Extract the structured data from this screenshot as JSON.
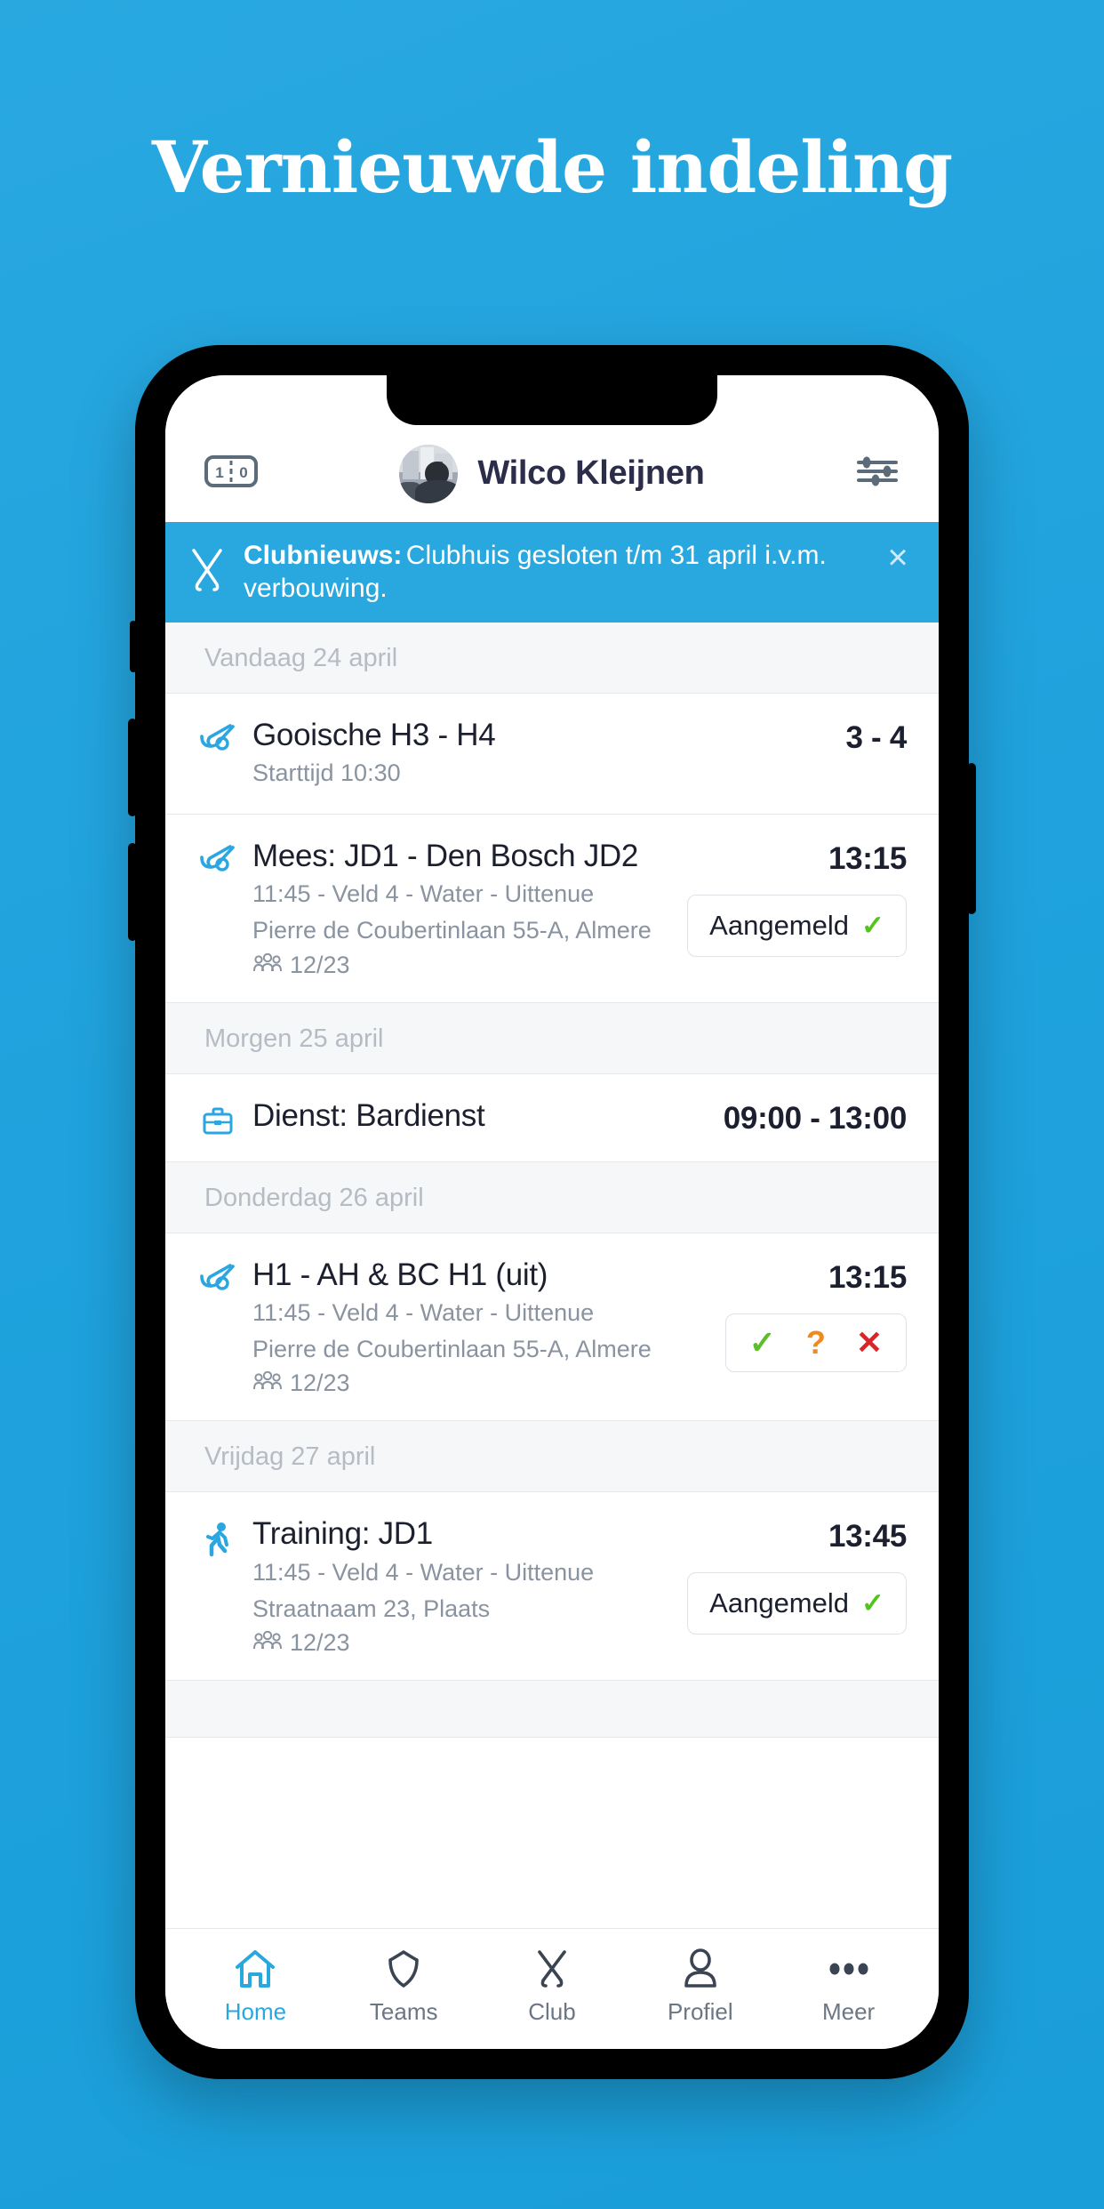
{
  "hero": {
    "title": "Vernieuwde indeling"
  },
  "colors": {
    "background": "#1fa2dd",
    "accent": "#29a8e0",
    "text_dark": "#1c1f2e",
    "text_muted": "#8a93a0",
    "day_label": "#b6bcc4",
    "yes_green": "#5cbe2b",
    "maybe_orange": "#f08a1d",
    "no_red": "#d9252a",
    "tick_green": "#52c41a"
  },
  "header": {
    "scoreboard_icon": "scoreboard-icon",
    "scoreboard_left": "1",
    "scoreboard_right": "0",
    "avatar_icon": "avatar",
    "user_name": "Wilco Kleijnen",
    "settings_icon": "sliders-icon"
  },
  "news_banner": {
    "icon": "crossed-sticks-icon",
    "title": "Clubnieuws:",
    "body": "Clubhuis gesloten t/m 31 april i.v.m. verbouwing.",
    "close_icon": "×"
  },
  "sections": [
    {
      "day_label": "Vandaag 24 april",
      "events": [
        {
          "icon": "hockey-sticks-icon",
          "title": "Gooische H3 - H4",
          "line2": "Starttijd 10:30",
          "line3": "",
          "attendance": "",
          "right_value": "3 - 4",
          "action_type": "none",
          "action_label": ""
        },
        {
          "icon": "hockey-sticks-icon",
          "title": "Mees: JD1 - Den Bosch JD2",
          "line2": "11:45 - Veld 4 - Water - Uittenue",
          "line3": "Pierre de Coubertinlaan 55-A, Almere",
          "attendance": "12/23",
          "right_value": "13:15",
          "action_type": "registered",
          "action_label": "Aangemeld"
        }
      ]
    },
    {
      "day_label": "Morgen 25 april",
      "events": [
        {
          "icon": "briefcase-icon",
          "title": "Dienst: Bardienst",
          "line2": "",
          "line3": "",
          "attendance": "",
          "right_value": "09:00 - 13:00",
          "action_type": "none",
          "action_label": ""
        }
      ]
    },
    {
      "day_label": "Donderdag 26 april",
      "events": [
        {
          "icon": "hockey-sticks-icon",
          "title": "H1 - AH & BC H1 (uit)",
          "line2": "11:45 - Veld 4 - Water - Uittenue",
          "line3": "Pierre de Coubertinlaan 55-A, Almere",
          "attendance": "12/23",
          "right_value": "13:15",
          "action_type": "choice",
          "action_label": ""
        }
      ]
    },
    {
      "day_label": "Vrijdag 27 april",
      "events": [
        {
          "icon": "running-icon",
          "title": "Training: JD1",
          "line2": "11:45 - Veld 4 - Water - Uittenue",
          "line3": "Straatnaam 23, Plaats",
          "attendance": "12/23",
          "right_value": "13:45",
          "action_type": "registered",
          "action_label": "Aangemeld"
        }
      ]
    }
  ],
  "choice_buttons": {
    "yes": "✓",
    "maybe": "?",
    "no": "✕"
  },
  "bottom_nav": [
    {
      "label": "Home",
      "icon": "home-icon",
      "active": true
    },
    {
      "label": "Teams",
      "icon": "shield-icon",
      "active": false
    },
    {
      "label": "Club",
      "icon": "crossed-sticks-icon",
      "active": false
    },
    {
      "label": "Profiel",
      "icon": "person-icon",
      "active": false
    },
    {
      "label": "Meer",
      "icon": "ellipsis-icon",
      "active": false
    }
  ]
}
